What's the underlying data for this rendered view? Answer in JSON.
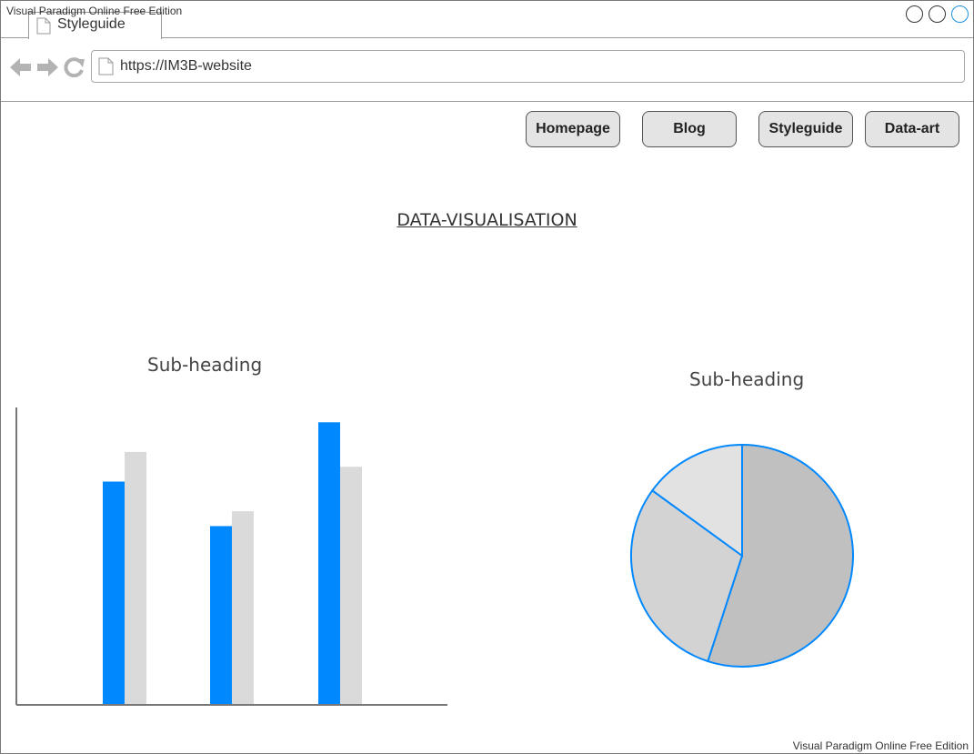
{
  "watermark": "Visual Paradigm Online Free Edition",
  "browser": {
    "tab_label": "Styleguide",
    "url": "https://IM3B-website"
  },
  "nav": {
    "items": [
      "Homepage",
      "Blog",
      "Styleguide",
      "Data-art"
    ]
  },
  "page": {
    "title": "DATA-VISUALISATION"
  },
  "charts": {
    "bar_subheading": "Sub-heading",
    "pie_subheading": "Sub-heading"
  },
  "colors": {
    "accent": "#0088ff",
    "secondary_bar": "#dadada",
    "pie_slices": [
      "#c0c0c0",
      "#d3d3d3",
      "#e2e2e2"
    ]
  },
  "chart_data": [
    {
      "type": "bar",
      "categories": [
        "",
        "",
        ""
      ],
      "series": [
        {
          "values": [
            75,
            60,
            95
          ]
        },
        {
          "values": [
            85,
            65,
            80
          ]
        }
      ],
      "ylim": [
        0,
        100
      ],
      "grid": false,
      "title": "Sub-heading"
    },
    {
      "type": "pie",
      "values": [
        55,
        30,
        15
      ],
      "title": "Sub-heading"
    }
  ]
}
